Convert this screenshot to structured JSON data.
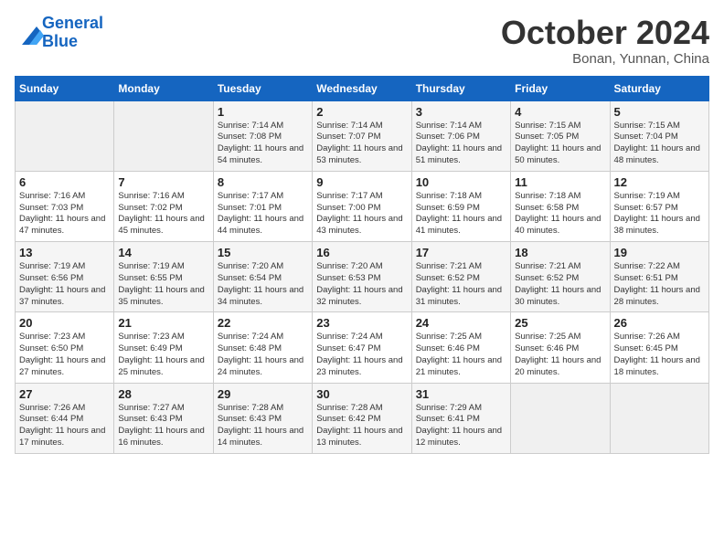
{
  "header": {
    "logo_line1": "General",
    "logo_line2": "Blue",
    "month": "October 2024",
    "location": "Bonan, Yunnan, China"
  },
  "days_of_week": [
    "Sunday",
    "Monday",
    "Tuesday",
    "Wednesday",
    "Thursday",
    "Friday",
    "Saturday"
  ],
  "weeks": [
    [
      {
        "day": "",
        "info": ""
      },
      {
        "day": "",
        "info": ""
      },
      {
        "day": "1",
        "info": "Sunrise: 7:14 AM\nSunset: 7:08 PM\nDaylight: 11 hours and 54 minutes."
      },
      {
        "day": "2",
        "info": "Sunrise: 7:14 AM\nSunset: 7:07 PM\nDaylight: 11 hours and 53 minutes."
      },
      {
        "day": "3",
        "info": "Sunrise: 7:14 AM\nSunset: 7:06 PM\nDaylight: 11 hours and 51 minutes."
      },
      {
        "day": "4",
        "info": "Sunrise: 7:15 AM\nSunset: 7:05 PM\nDaylight: 11 hours and 50 minutes."
      },
      {
        "day": "5",
        "info": "Sunrise: 7:15 AM\nSunset: 7:04 PM\nDaylight: 11 hours and 48 minutes."
      }
    ],
    [
      {
        "day": "6",
        "info": "Sunrise: 7:16 AM\nSunset: 7:03 PM\nDaylight: 11 hours and 47 minutes."
      },
      {
        "day": "7",
        "info": "Sunrise: 7:16 AM\nSunset: 7:02 PM\nDaylight: 11 hours and 45 minutes."
      },
      {
        "day": "8",
        "info": "Sunrise: 7:17 AM\nSunset: 7:01 PM\nDaylight: 11 hours and 44 minutes."
      },
      {
        "day": "9",
        "info": "Sunrise: 7:17 AM\nSunset: 7:00 PM\nDaylight: 11 hours and 43 minutes."
      },
      {
        "day": "10",
        "info": "Sunrise: 7:18 AM\nSunset: 6:59 PM\nDaylight: 11 hours and 41 minutes."
      },
      {
        "day": "11",
        "info": "Sunrise: 7:18 AM\nSunset: 6:58 PM\nDaylight: 11 hours and 40 minutes."
      },
      {
        "day": "12",
        "info": "Sunrise: 7:19 AM\nSunset: 6:57 PM\nDaylight: 11 hours and 38 minutes."
      }
    ],
    [
      {
        "day": "13",
        "info": "Sunrise: 7:19 AM\nSunset: 6:56 PM\nDaylight: 11 hours and 37 minutes."
      },
      {
        "day": "14",
        "info": "Sunrise: 7:19 AM\nSunset: 6:55 PM\nDaylight: 11 hours and 35 minutes."
      },
      {
        "day": "15",
        "info": "Sunrise: 7:20 AM\nSunset: 6:54 PM\nDaylight: 11 hours and 34 minutes."
      },
      {
        "day": "16",
        "info": "Sunrise: 7:20 AM\nSunset: 6:53 PM\nDaylight: 11 hours and 32 minutes."
      },
      {
        "day": "17",
        "info": "Sunrise: 7:21 AM\nSunset: 6:52 PM\nDaylight: 11 hours and 31 minutes."
      },
      {
        "day": "18",
        "info": "Sunrise: 7:21 AM\nSunset: 6:52 PM\nDaylight: 11 hours and 30 minutes."
      },
      {
        "day": "19",
        "info": "Sunrise: 7:22 AM\nSunset: 6:51 PM\nDaylight: 11 hours and 28 minutes."
      }
    ],
    [
      {
        "day": "20",
        "info": "Sunrise: 7:23 AM\nSunset: 6:50 PM\nDaylight: 11 hours and 27 minutes."
      },
      {
        "day": "21",
        "info": "Sunrise: 7:23 AM\nSunset: 6:49 PM\nDaylight: 11 hours and 25 minutes."
      },
      {
        "day": "22",
        "info": "Sunrise: 7:24 AM\nSunset: 6:48 PM\nDaylight: 11 hours and 24 minutes."
      },
      {
        "day": "23",
        "info": "Sunrise: 7:24 AM\nSunset: 6:47 PM\nDaylight: 11 hours and 23 minutes."
      },
      {
        "day": "24",
        "info": "Sunrise: 7:25 AM\nSunset: 6:46 PM\nDaylight: 11 hours and 21 minutes."
      },
      {
        "day": "25",
        "info": "Sunrise: 7:25 AM\nSunset: 6:46 PM\nDaylight: 11 hours and 20 minutes."
      },
      {
        "day": "26",
        "info": "Sunrise: 7:26 AM\nSunset: 6:45 PM\nDaylight: 11 hours and 18 minutes."
      }
    ],
    [
      {
        "day": "27",
        "info": "Sunrise: 7:26 AM\nSunset: 6:44 PM\nDaylight: 11 hours and 17 minutes."
      },
      {
        "day": "28",
        "info": "Sunrise: 7:27 AM\nSunset: 6:43 PM\nDaylight: 11 hours and 16 minutes."
      },
      {
        "day": "29",
        "info": "Sunrise: 7:28 AM\nSunset: 6:43 PM\nDaylight: 11 hours and 14 minutes."
      },
      {
        "day": "30",
        "info": "Sunrise: 7:28 AM\nSunset: 6:42 PM\nDaylight: 11 hours and 13 minutes."
      },
      {
        "day": "31",
        "info": "Sunrise: 7:29 AM\nSunset: 6:41 PM\nDaylight: 11 hours and 12 minutes."
      },
      {
        "day": "",
        "info": ""
      },
      {
        "day": "",
        "info": ""
      }
    ]
  ]
}
